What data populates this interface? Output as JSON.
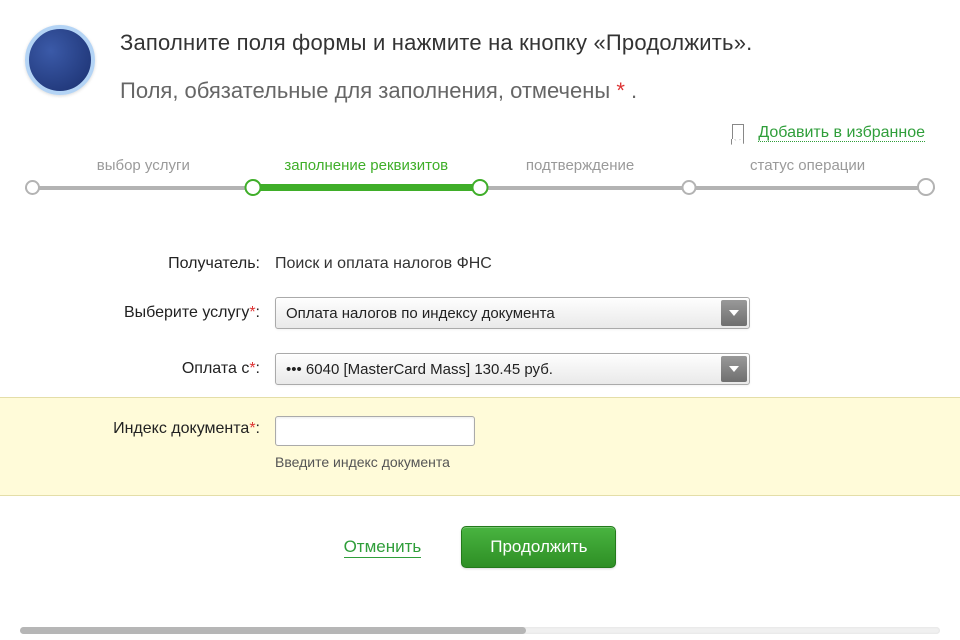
{
  "header": {
    "title1": "Заполните поля формы и нажмите на кнопку «Продолжить».",
    "title2_prefix": "Поля, обязательные для заполнения, отмечены ",
    "title2_suffix": " ."
  },
  "favorites": {
    "label": "Добавить в избранное"
  },
  "steps": {
    "s1": "выбор услуги",
    "s2": "заполнение реквизитов",
    "s3": "подтверждение",
    "s4": "статус операции"
  },
  "form": {
    "recipient": {
      "label": "Получатель:",
      "value": "Поиск и оплата налогов ФНС"
    },
    "service": {
      "label": "Выберите услугу",
      "value": "Оплата налогов по индексу документа"
    },
    "payfrom": {
      "label": "Оплата с",
      "value": "••• 6040 [MasterCard Mass] 130.45 руб."
    },
    "docindex": {
      "label": "Индекс документа",
      "value": "",
      "hint": "Введите индекс документа"
    },
    "required_marker": "*",
    "colon": ":"
  },
  "actions": {
    "cancel": "Отменить",
    "continue": "Продолжить"
  }
}
